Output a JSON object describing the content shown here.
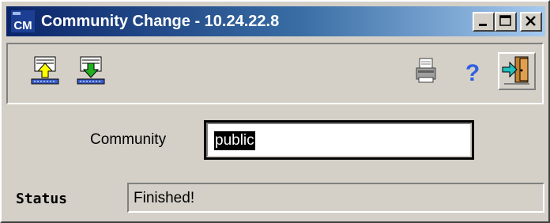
{
  "window": {
    "title": "Community Change - 10.24.22.8",
    "app_icon_text": "CM"
  },
  "toolbar": {
    "buttons": [
      {
        "name": "upload",
        "icon": "upload-icon"
      },
      {
        "name": "download",
        "icon": "download-icon"
      },
      {
        "name": "print",
        "icon": "printer-icon"
      },
      {
        "name": "help",
        "icon": "question-icon"
      },
      {
        "name": "exit",
        "icon": "exit-door-icon"
      }
    ]
  },
  "form": {
    "community_label": "Community",
    "community_value": "public",
    "status_label": "Status",
    "status_value": "Finished!"
  },
  "colors": {
    "title_start": "#0a246a",
    "title_end": "#a6caf0",
    "face": "#d4d0c8"
  }
}
